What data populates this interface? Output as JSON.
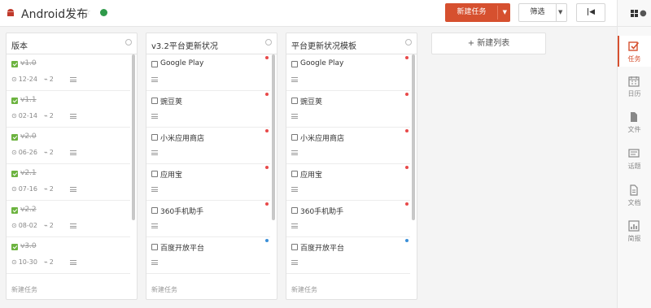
{
  "header": {
    "title": "Android发布",
    "new_task": "新建任务",
    "filter": "筛选",
    "first": "|◀"
  },
  "sidebar": {
    "items": [
      {
        "label": "任务",
        "icon": "task-check-icon",
        "active": true
      },
      {
        "label": "日历",
        "icon": "calendar-icon",
        "active": false
      },
      {
        "label": "文件",
        "icon": "file-icon",
        "active": false
      },
      {
        "label": "话题",
        "icon": "topic-icon",
        "active": false
      },
      {
        "label": "文档",
        "icon": "document-icon",
        "active": false
      },
      {
        "label": "简报",
        "icon": "report-icon",
        "active": false
      }
    ]
  },
  "columns": [
    {
      "title": "版本",
      "footer": "新建任务",
      "cards": [
        {
          "name": "v1.0",
          "done": true,
          "date": "12-24",
          "attach": "2"
        },
        {
          "name": "v1.1",
          "done": true,
          "date": "02-14",
          "attach": "2"
        },
        {
          "name": "v2.0",
          "done": true,
          "date": "06-26",
          "attach": "2"
        },
        {
          "name": "v2.1",
          "done": true,
          "date": "07-16",
          "attach": "2"
        },
        {
          "name": "v2.2",
          "done": true,
          "date": "08-02",
          "attach": "2"
        },
        {
          "name": "v3.0",
          "done": true,
          "date": "10-30",
          "attach": "2"
        }
      ]
    },
    {
      "title": "v3.2平台更新状况",
      "footer": "新建任务",
      "cards": [
        {
          "name": "Google Play",
          "done": false,
          "priority": "#e84a4a"
        },
        {
          "name": "豌豆荚",
          "done": false,
          "priority": "#e84a4a"
        },
        {
          "name": "小米应用商店",
          "done": false,
          "priority": "#e84a4a"
        },
        {
          "name": "应用宝",
          "done": false,
          "priority": "#e84a4a"
        },
        {
          "name": "360手机助手",
          "done": false,
          "priority": "#e84a4a"
        },
        {
          "name": "百度开放平台",
          "done": false,
          "priority": "#3a8fd8"
        }
      ]
    },
    {
      "title": "平台更新状况模板",
      "footer": "新建任务",
      "cards": [
        {
          "name": "Google Play",
          "done": false,
          "priority": "#e84a4a"
        },
        {
          "name": "豌豆荚",
          "done": false,
          "priority": "#e84a4a"
        },
        {
          "name": "小米应用商店",
          "done": false,
          "priority": "#e84a4a"
        },
        {
          "name": "应用宝",
          "done": false,
          "priority": "#e84a4a"
        },
        {
          "name": "360手机助手",
          "done": false,
          "priority": "#e84a4a"
        },
        {
          "name": "百度开放平台",
          "done": false,
          "priority": "#3a8fd8"
        }
      ]
    }
  ],
  "add_list": "+ 新建列表",
  "colors": {
    "accent": "#d6502f",
    "done": "#6cb33f",
    "high": "#e84a4a",
    "normal": "#3a8fd8"
  }
}
